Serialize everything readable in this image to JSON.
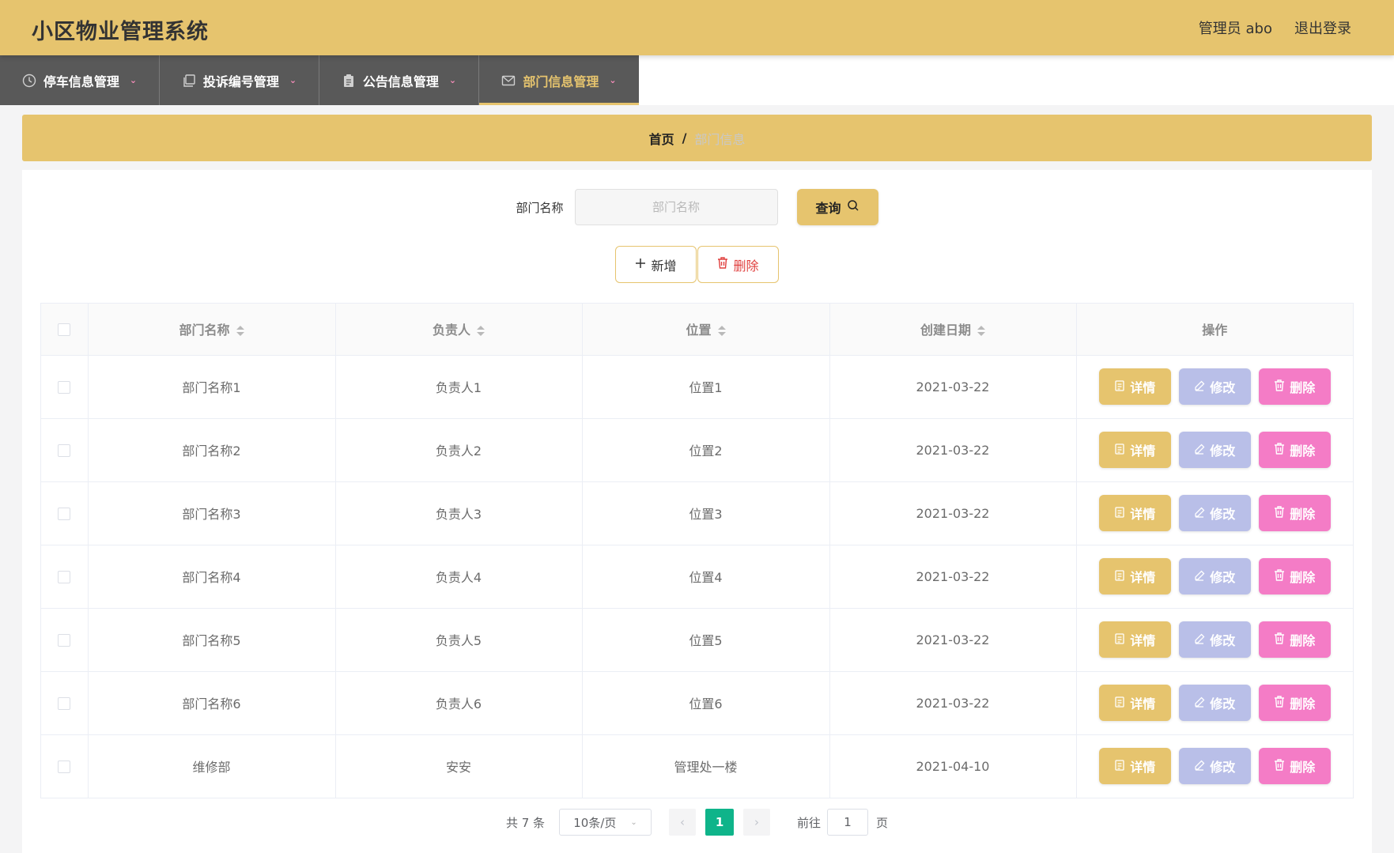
{
  "app": {
    "title": "小区物业管理系统",
    "user_label": "管理员 abo",
    "logout_label": "退出登录"
  },
  "nav": {
    "items": [
      {
        "label": "停车信息管理",
        "icon": "clock-icon",
        "active": false
      },
      {
        "label": "投诉编号管理",
        "icon": "copy-icon",
        "active": false
      },
      {
        "label": "公告信息管理",
        "icon": "clipboard-icon",
        "active": false
      },
      {
        "label": "部门信息管理",
        "icon": "mail-icon",
        "active": true
      }
    ]
  },
  "breadcrumb": {
    "home": "首页",
    "separator": "/",
    "current": "部门信息"
  },
  "search": {
    "label": "部门名称",
    "placeholder": "部门名称",
    "value": "",
    "button_label": "查询"
  },
  "actions": {
    "add_label": "新增",
    "delete_label": "删除"
  },
  "table": {
    "headers": [
      "部门名称",
      "负责人",
      "位置",
      "创建日期",
      "操作"
    ],
    "row_actions": {
      "detail": "详情",
      "edit": "修改",
      "delete": "删除"
    },
    "rows": [
      {
        "name": "部门名称1",
        "manager": "负责人1",
        "location": "位置1",
        "date": "2021-03-22"
      },
      {
        "name": "部门名称2",
        "manager": "负责人2",
        "location": "位置2",
        "date": "2021-03-22"
      },
      {
        "name": "部门名称3",
        "manager": "负责人3",
        "location": "位置3",
        "date": "2021-03-22"
      },
      {
        "name": "部门名称4",
        "manager": "负责人4",
        "location": "位置4",
        "date": "2021-03-22"
      },
      {
        "name": "部门名称5",
        "manager": "负责人5",
        "location": "位置5",
        "date": "2021-03-22"
      },
      {
        "name": "部门名称6",
        "manager": "负责人6",
        "location": "位置6",
        "date": "2021-03-22"
      },
      {
        "name": "维修部",
        "manager": "安安",
        "location": "管理处一楼",
        "date": "2021-04-10"
      }
    ]
  },
  "pagination": {
    "total_label": "共 7 条",
    "page_size_label": "10条/页",
    "current_page": "1",
    "goto_label": "前往",
    "goto_value": "1",
    "page_suffix": "页"
  },
  "colors": {
    "accent": "#e6c46e",
    "nav_bg": "#595959",
    "edit": "#b9bfe8",
    "delete": "#f47cc6",
    "page_active": "#0fb48a"
  }
}
